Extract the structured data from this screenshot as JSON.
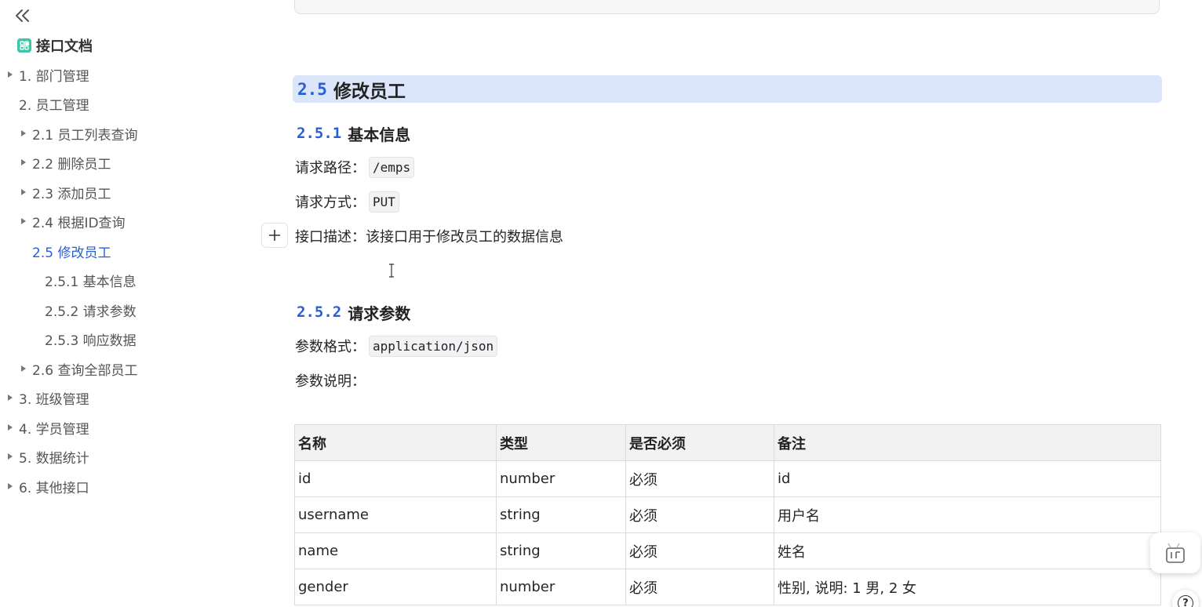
{
  "sidebar": {
    "doc_title": "接口文档",
    "items": [
      {
        "label": "1. 部门管理"
      },
      {
        "label": "2. 员工管理"
      },
      {
        "label": "2.1 员工列表查询"
      },
      {
        "label": "2.2 删除员工"
      },
      {
        "label": "2.3 添加员工"
      },
      {
        "label": "2.4 根据ID查询"
      },
      {
        "label": "2.5 修改员工"
      },
      {
        "label": "2.5.1 基本信息"
      },
      {
        "label": "2.5.2 请求参数"
      },
      {
        "label": "2.5.3 响应数据"
      },
      {
        "label": "2.6 查询全部员工"
      },
      {
        "label": "3. 班级管理"
      },
      {
        "label": "4. 学员管理"
      },
      {
        "label": "5. 数据统计"
      },
      {
        "label": "6. 其他接口"
      }
    ]
  },
  "content": {
    "h2": {
      "num": "2.5",
      "text": "修改员工"
    },
    "basic": {
      "num": "2.5.1",
      "text": "基本信息",
      "path_label": "请求路径：",
      "path_value": "/emps",
      "method_label": "请求方式：",
      "method_value": "PUT",
      "desc": "接口描述：该接口用于修改员工的数据信息"
    },
    "params": {
      "num": "2.5.2",
      "text": "请求参数",
      "format_label": "参数格式：",
      "format_value": "application/json",
      "desc_label": "参数说明："
    },
    "table": {
      "headers": [
        "名称",
        "类型",
        "是否必须",
        "备注"
      ],
      "rows": [
        [
          "id",
          "number",
          "必须",
          "id"
        ],
        [
          "username",
          "string",
          "必须",
          "用户名"
        ],
        [
          "name",
          "string",
          "必须",
          "姓名"
        ],
        [
          "gender",
          "number",
          "必须",
          "性别, 说明: 1 男, 2 女"
        ]
      ]
    },
    "help_label": "?"
  },
  "colors": {
    "accent": "#2a5fd1",
    "heading_bar": "#dbe6fb",
    "doc_icon": "#3cc7a8"
  },
  "icons": [
    "double-chevron-left-icon",
    "doc-grid-icon",
    "caret-right-icon",
    "plus-icon",
    "text-cursor-icon",
    "reader-icon",
    "help-icon"
  ]
}
